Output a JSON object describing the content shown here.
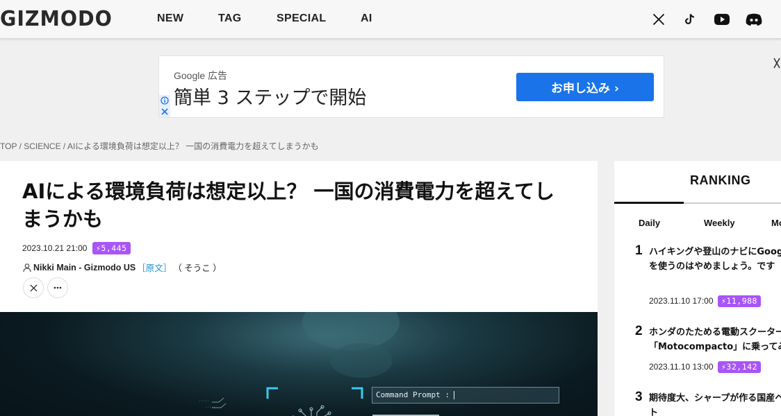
{
  "header": {
    "logo": "GIZMODO",
    "nav": [
      "NEW",
      "TAG",
      "SPECIAL",
      "AI"
    ],
    "social_icons": [
      "x-icon",
      "tiktok-icon",
      "youtube-icon",
      "discord-icon"
    ]
  },
  "ad": {
    "label": "Google 広告",
    "headline": "簡単 3 ステップで開始",
    "cta": "お申し込み ›"
  },
  "breadcrumb": {
    "top": "TOP",
    "sep1": " / ",
    "category": "SCIENCE",
    "sep2": " / ",
    "current": "AIによる環境負荷は想定以上？ 一国の消費電力を超えてしまうかも"
  },
  "article": {
    "title": "AIによる環境負荷は想定以上？ 一国の消費電力を超えてしまうかも",
    "date": "2023.10.21 21:00",
    "views": "⚡5,445",
    "author": "Nikki Main - Gizmodo US",
    "original_link": "［原文］",
    "translator": "（ そうこ ）",
    "hero_text": "Command Prompt :"
  },
  "ranking": {
    "title": "RANKING",
    "tabs": [
      "Daily",
      "Weekly",
      "Monthly"
    ],
    "items": [
      {
        "rank": "1",
        "title": "ハイキングや登山のナビにGoogleマップを使うのはやめましょう。です",
        "date": "2023.11.10 17:00",
        "views": "⚡11,988"
      },
      {
        "rank": "2",
        "title": "ホンダのたためる電動スクーター「Motocompacto」に乗ってみた",
        "date": "2023.11.10 13:00",
        "views": "⚡32,142"
      },
      {
        "rank": "3",
        "title": "期待度大、シャープが作る国産ヘッドセット",
        "date": "",
        "views": ""
      }
    ]
  },
  "colors": {
    "accent_purple": "#a855f7",
    "ad_blue": "#1a73e8",
    "link_blue": "#1a8fd0"
  }
}
